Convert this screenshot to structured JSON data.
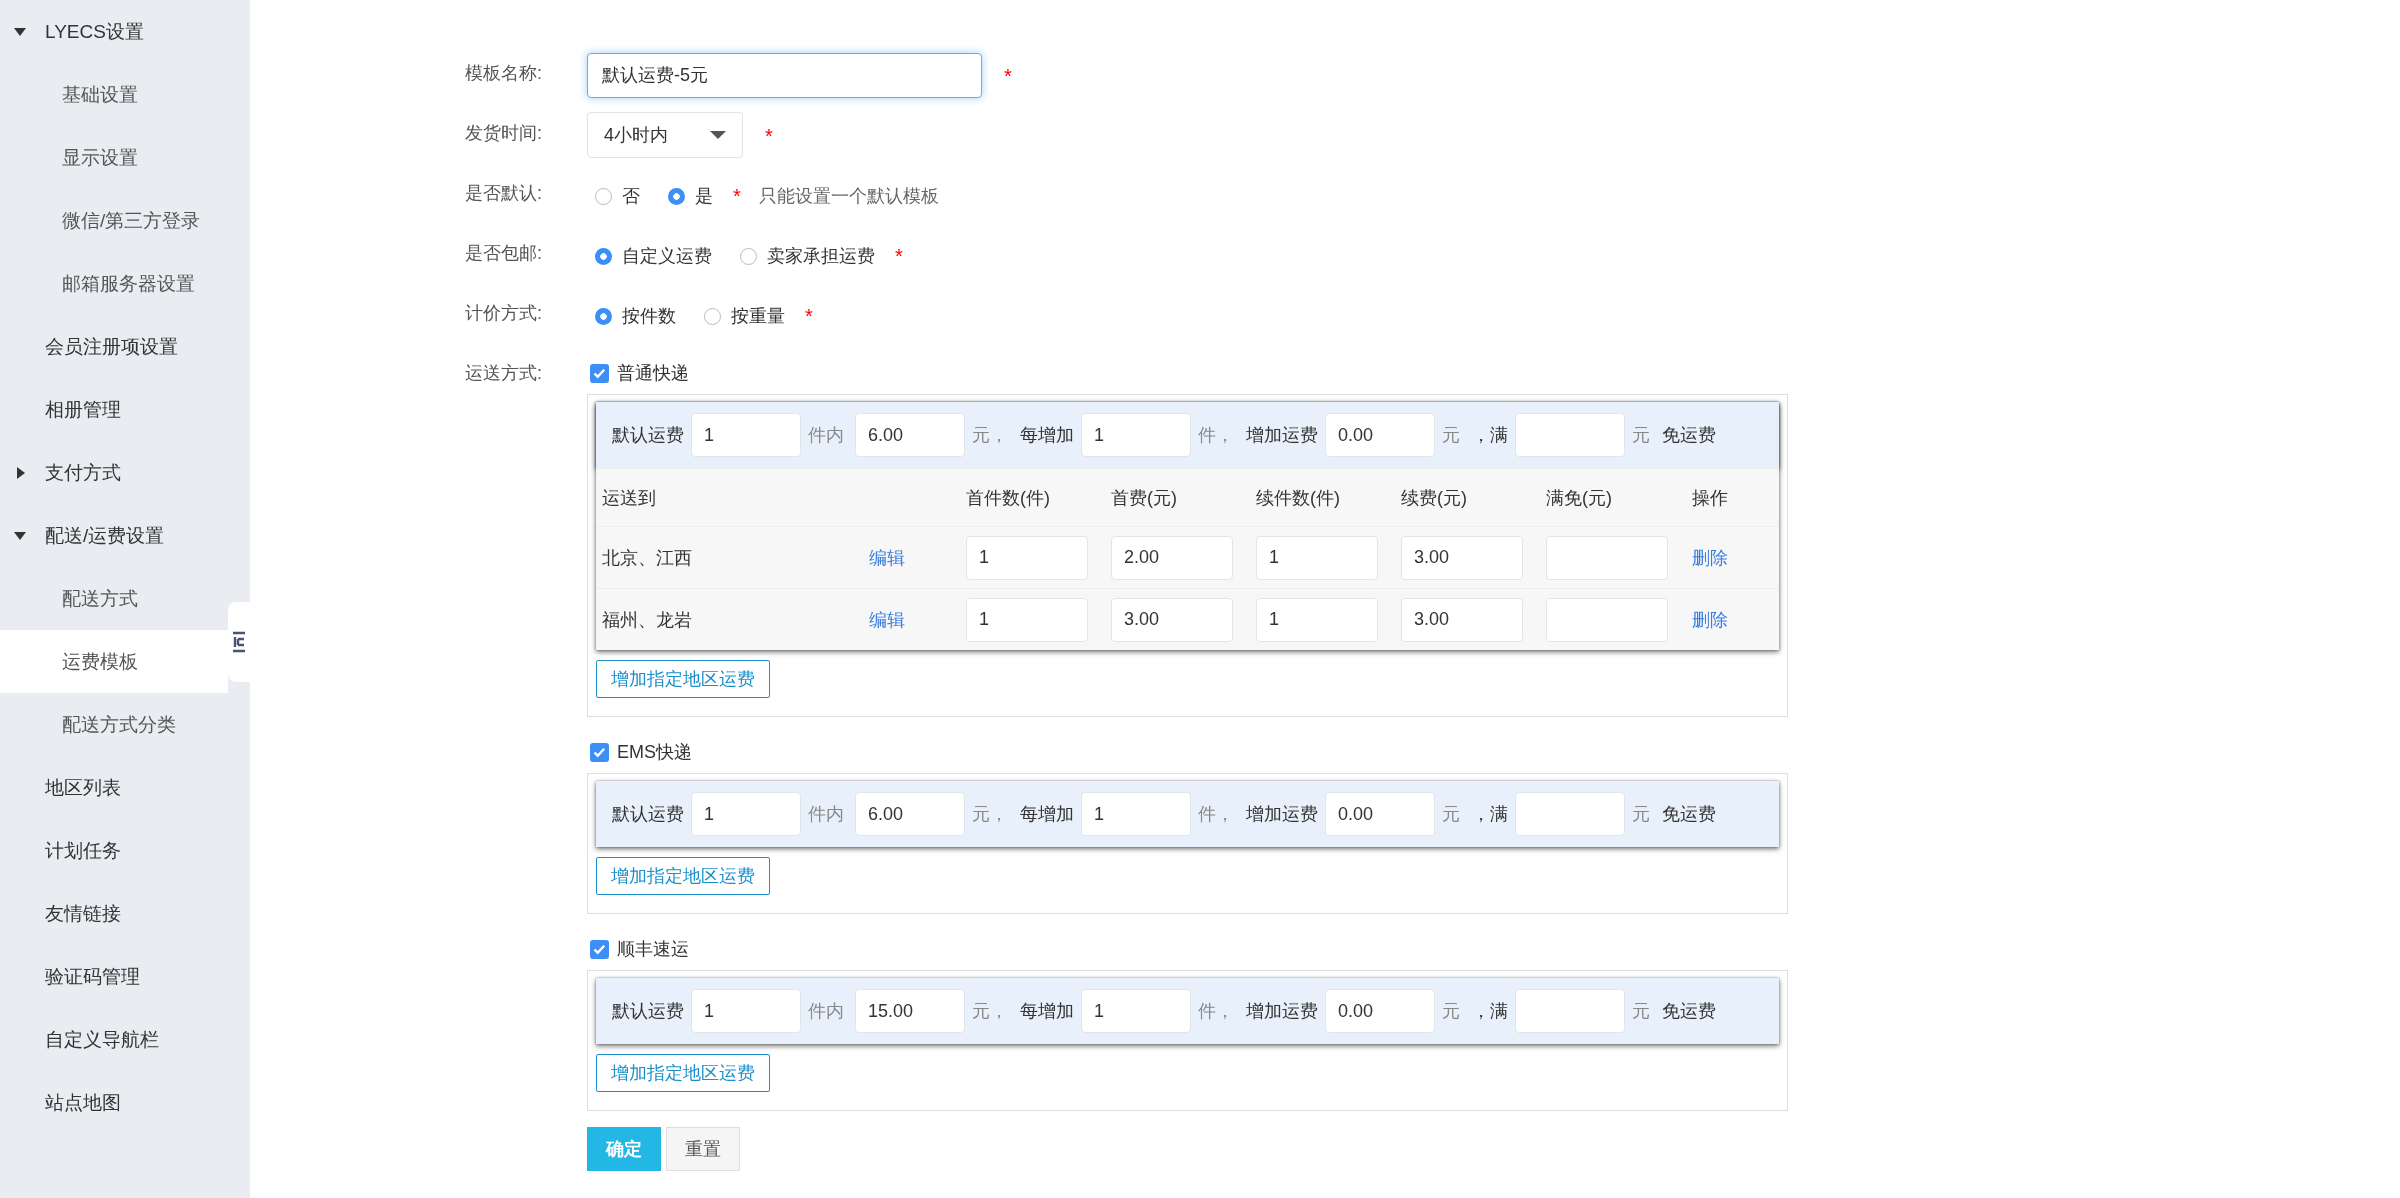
{
  "sidebar": {
    "items": [
      {
        "label": "LYECS设置",
        "expanded": true,
        "selected": false,
        "children": [
          {
            "label": "基础设置",
            "selected": false
          },
          {
            "label": "显示设置",
            "selected": false
          },
          {
            "label": "微信/第三方登录",
            "selected": false
          },
          {
            "label": "邮箱服务器设置",
            "selected": false
          }
        ]
      },
      {
        "label": "会员注册项设置",
        "selected": false
      },
      {
        "label": "相册管理",
        "selected": false
      },
      {
        "label": "支付方式",
        "expanded": false,
        "selected": false
      },
      {
        "label": "配送/运费设置",
        "expanded": true,
        "selected": false,
        "children": [
          {
            "label": "配送方式",
            "selected": false
          },
          {
            "label": "运费模板",
            "selected": true
          },
          {
            "label": "配送方式分类",
            "selected": false
          }
        ]
      },
      {
        "label": "地区列表",
        "selected": false
      },
      {
        "label": "计划任务",
        "selected": false
      },
      {
        "label": "友情链接",
        "selected": false
      },
      {
        "label": "验证码管理",
        "selected": false
      },
      {
        "label": "自定义导航栏",
        "selected": false
      },
      {
        "label": "站点地图",
        "selected": false
      }
    ]
  },
  "form": {
    "rows": [
      {
        "kind": "text",
        "label": "模板名称:",
        "value": "默认运费-5元",
        "required": "*"
      },
      {
        "kind": "select",
        "label": "发货时间:",
        "value": "4小时内",
        "required": "*"
      },
      {
        "kind": "radio",
        "label": "是否默认:",
        "options": [
          {
            "label": "否",
            "selected": false
          },
          {
            "label": "是",
            "selected": true
          }
        ],
        "required": "*",
        "hint": "只能设置一个默认模板"
      },
      {
        "kind": "radio",
        "label": "是否包邮:",
        "options": [
          {
            "label": "自定义运费",
            "selected": true
          },
          {
            "label": "卖家承担运费",
            "selected": false
          }
        ],
        "required": "*"
      },
      {
        "kind": "radio",
        "label": "计价方式:",
        "options": [
          {
            "label": "按件数",
            "selected": true
          },
          {
            "label": "按重量",
            "selected": false
          }
        ],
        "required": "*"
      }
    ],
    "shipping": {
      "label": "运送方式:",
      "methods": [
        {
          "label": "普通快递",
          "checked": true,
          "fee_parts": [
            {
              "kind": "label",
              "text": "默认运费"
            },
            {
              "kind": "input",
              "value": "1"
            },
            {
              "kind": "unit",
              "text": "件内"
            },
            {
              "kind": "input",
              "value": "6.00"
            },
            {
              "kind": "unit",
              "text": "元，"
            },
            {
              "kind": "label",
              "text": "每增加"
            },
            {
              "kind": "input",
              "value": "1"
            },
            {
              "kind": "unit",
              "text": "件，"
            },
            {
              "kind": "label",
              "text": "增加运费"
            },
            {
              "kind": "input",
              "value": "0.00"
            },
            {
              "kind": "unit",
              "text": "元"
            },
            {
              "kind": "label",
              "text": "，满"
            },
            {
              "kind": "input"
            },
            {
              "kind": "unit",
              "text": "元"
            },
            {
              "kind": "label",
              "text": "免运费"
            }
          ],
          "regions": {
            "columns": [
              "运送到",
              "首件数(件)",
              "首费(元)",
              "续件数(件)",
              "续费(元)",
              "满免(元)",
              "操作"
            ],
            "rows": [
              {
                "region": "北京、江西",
                "edit": "编辑",
                "first_qty": "1",
                "first_fee": "2.00",
                "extra_qty": "1",
                "extra_fee": "3.00",
                "delete": "删除"
              },
              {
                "region": "福州、龙岩",
                "edit": "编辑",
                "first_qty": "1",
                "first_fee": "3.00",
                "extra_qty": "1",
                "extra_fee": "3.00",
                "delete": "删除"
              }
            ]
          },
          "add_button": "增加指定地区运费"
        },
        {
          "label": "EMS快递",
          "checked": true,
          "fee_parts": [
            {
              "kind": "label",
              "text": "默认运费"
            },
            {
              "kind": "input",
              "value": "1"
            },
            {
              "kind": "unit",
              "text": "件内"
            },
            {
              "kind": "input",
              "value": "6.00"
            },
            {
              "kind": "unit",
              "text": "元，"
            },
            {
              "kind": "label",
              "text": "每增加"
            },
            {
              "kind": "input",
              "value": "1"
            },
            {
              "kind": "unit",
              "text": "件，"
            },
            {
              "kind": "label",
              "text": "增加运费"
            },
            {
              "kind": "input",
              "value": "0.00"
            },
            {
              "kind": "unit",
              "text": "元"
            },
            {
              "kind": "label",
              "text": "，满"
            },
            {
              "kind": "input"
            },
            {
              "kind": "unit",
              "text": "元"
            },
            {
              "kind": "label",
              "text": "免运费"
            }
          ],
          "add_button": "增加指定地区运费"
        },
        {
          "label": "顺丰速运",
          "checked": true,
          "fee_parts": [
            {
              "kind": "label",
              "text": "默认运费"
            },
            {
              "kind": "input",
              "value": "1"
            },
            {
              "kind": "unit",
              "text": "件内"
            },
            {
              "kind": "input",
              "value": "15.00"
            },
            {
              "kind": "unit",
              "text": "元，"
            },
            {
              "kind": "label",
              "text": "每增加"
            },
            {
              "kind": "input",
              "value": "1"
            },
            {
              "kind": "unit",
              "text": "件，"
            },
            {
              "kind": "label",
              "text": "增加运费"
            },
            {
              "kind": "input",
              "value": "0.00"
            },
            {
              "kind": "unit",
              "text": "元"
            },
            {
              "kind": "label",
              "text": "，满"
            },
            {
              "kind": "input"
            },
            {
              "kind": "unit",
              "text": "元"
            },
            {
              "kind": "label",
              "text": "免运费"
            }
          ],
          "add_button": "增加指定地区运费"
        }
      ]
    },
    "buttons": [
      {
        "kind": "primary",
        "label": "确定"
      },
      {
        "kind": "default",
        "label": "重置"
      }
    ]
  }
}
